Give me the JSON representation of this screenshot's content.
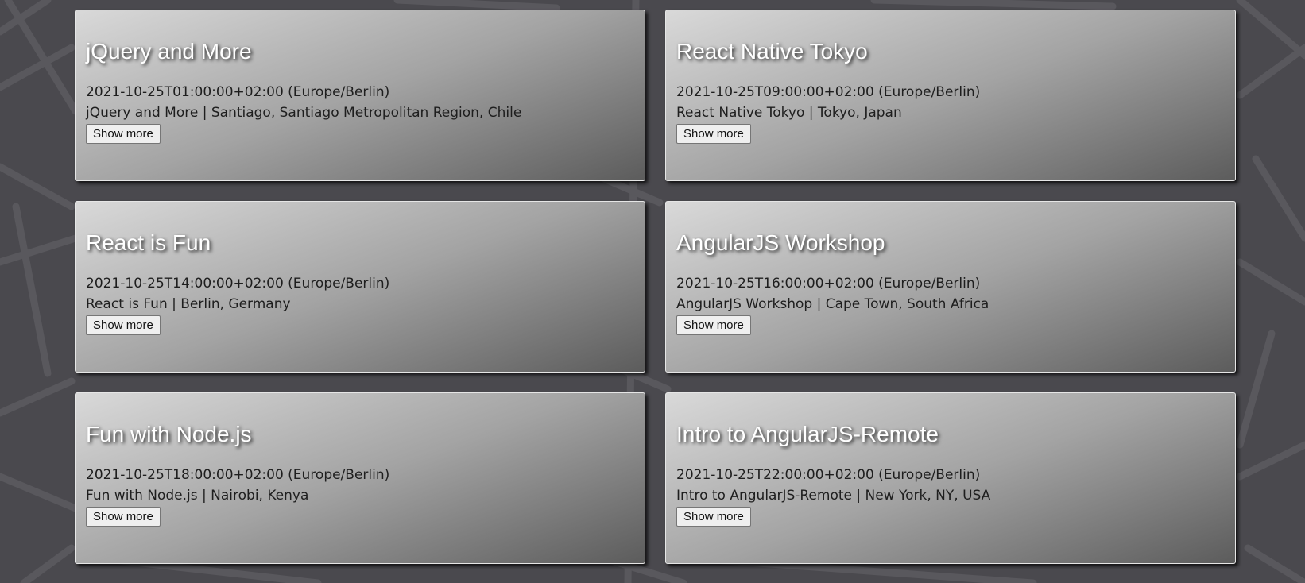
{
  "events": [
    {
      "title": "jQuery and More",
      "date": "2021-10-25T01:00:00+02:00 (Europe/Berlin)",
      "description": "jQuery and More | Santiago, Santiago Metropolitan Region, Chile",
      "button_label": "Show more"
    },
    {
      "title": "React Native Tokyo",
      "date": "2021-10-25T09:00:00+02:00 (Europe/Berlin)",
      "description": "React Native Tokyo | Tokyo, Japan",
      "button_label": "Show more"
    },
    {
      "title": "React is Fun",
      "date": "2021-10-25T14:00:00+02:00 (Europe/Berlin)",
      "description": "React is Fun | Berlin, Germany",
      "button_label": "Show more"
    },
    {
      "title": "AngularJS Workshop",
      "date": "2021-10-25T16:00:00+02:00 (Europe/Berlin)",
      "description": "AngularJS Workshop | Cape Town, South Africa",
      "button_label": "Show more"
    },
    {
      "title": "Fun with Node.js",
      "date": "2021-10-25T18:00:00+02:00 (Europe/Berlin)",
      "description": "Fun with Node.js | Nairobi, Kenya",
      "button_label": "Show more"
    },
    {
      "title": "Intro to AngularJS-Remote",
      "date": "2021-10-25T22:00:00+02:00 (Europe/Berlin)",
      "description": "Intro to AngularJS-Remote | New York, NY, USA",
      "button_label": "Show more"
    }
  ],
  "colors": {
    "background": "#4a494e",
    "map_lines": "#59585d",
    "card_gradient_start": "#d9d9d9",
    "card_gradient_end": "#5c5c5c",
    "title_text": "#ffffff"
  }
}
